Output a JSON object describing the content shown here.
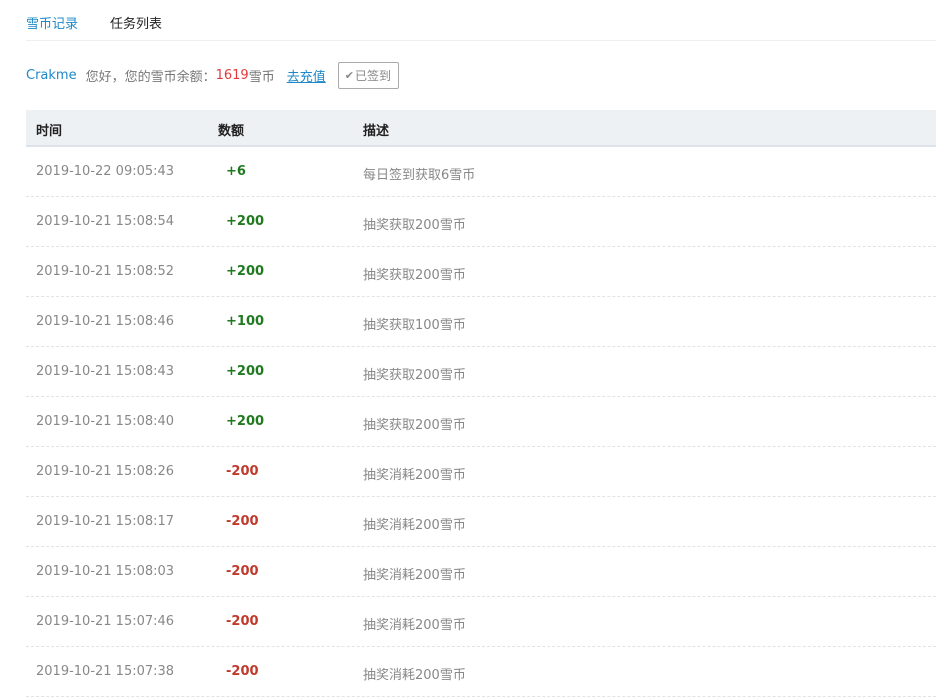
{
  "tabs": [
    {
      "label": "雪币记录",
      "active": true
    },
    {
      "label": "任务列表",
      "active": false
    }
  ],
  "user": {
    "name": "Crakme",
    "greeting": "您好，您的雪币余额：",
    "balance": "1619",
    "unit": "雪币",
    "recharge_label": "去充值",
    "signed_label": "已签到",
    "signed_icon": "check-icon"
  },
  "colors": {
    "accent": "#1e88c8",
    "positive": "#1f7a1f",
    "negative": "#c0392b",
    "balance": "#e4393c"
  },
  "table": {
    "headers": {
      "time": "时间",
      "amount": "数额",
      "desc": "描述"
    },
    "rows": [
      {
        "time": "2019-10-22 09:05:43",
        "amount": "+6",
        "desc": "每日签到获取6雪币"
      },
      {
        "time": "2019-10-21 15:08:54",
        "amount": "+200",
        "desc": "抽奖获取200雪币"
      },
      {
        "time": "2019-10-21 15:08:52",
        "amount": "+200",
        "desc": "抽奖获取200雪币"
      },
      {
        "time": "2019-10-21 15:08:46",
        "amount": "+100",
        "desc": "抽奖获取100雪币"
      },
      {
        "time": "2019-10-21 15:08:43",
        "amount": "+200",
        "desc": "抽奖获取200雪币"
      },
      {
        "time": "2019-10-21 15:08:40",
        "amount": "+200",
        "desc": "抽奖获取200雪币"
      },
      {
        "time": "2019-10-21 15:08:26",
        "amount": "-200",
        "desc": "抽奖消耗200雪币"
      },
      {
        "time": "2019-10-21 15:08:17",
        "amount": "-200",
        "desc": "抽奖消耗200雪币"
      },
      {
        "time": "2019-10-21 15:08:03",
        "amount": "-200",
        "desc": "抽奖消耗200雪币"
      },
      {
        "time": "2019-10-21 15:07:46",
        "amount": "-200",
        "desc": "抽奖消耗200雪币"
      },
      {
        "time": "2019-10-21 15:07:38",
        "amount": "-200",
        "desc": "抽奖消耗200雪币"
      }
    ]
  }
}
